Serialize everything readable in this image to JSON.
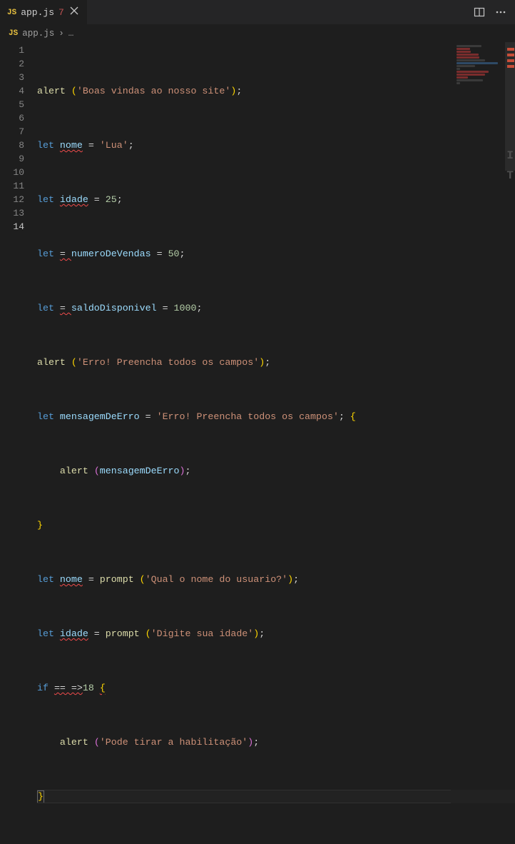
{
  "tab": {
    "icon_label": "JS",
    "filename": "app.js",
    "problem_count": "7"
  },
  "breadcrumb": {
    "icon_label": "JS",
    "filename": "app.js",
    "sep": "›",
    "trail": "…"
  },
  "gutter": {
    "start": 1,
    "end": 14,
    "active": 14
  },
  "code": {
    "l1_fn": "alert ",
    "l1_str": "'Boas vindas ao nosso site'",
    "l2_kw": "let ",
    "l2_var": "nome",
    "l2_eq": " = ",
    "l2_str": "'Lua'",
    "l3_kw": "let ",
    "l3_var": "idade",
    "l3_eq": " = ",
    "l3_num": "25",
    "l4_kw": "let ",
    "l4_eq1": "= ",
    "l4_var": "numeroDeVendas",
    "l4_eq2": " = ",
    "l4_num": "50",
    "l5_kw": "let ",
    "l5_eq1": "= ",
    "l5_var": "saldoDisponivel",
    "l5_eq2": " = ",
    "l5_num": "1000",
    "l6_fn": "alert ",
    "l6_str": "'Erro! Preencha todos os campos'",
    "l7_kw": "let ",
    "l7_var": "mensagemDeErro",
    "l7_eq": " = ",
    "l7_str": "'Erro! Preencha todos os campos'",
    "l8_fn": "alert ",
    "l8_arg": "mensagemDeErro",
    "l10_kw": "let ",
    "l10_var": "nome",
    "l10_eq": " = ",
    "l10_fn": "prompt ",
    "l10_str": "'Qual o nome do usuario?'",
    "l11_kw": "let ",
    "l11_var": "idade",
    "l11_eq": " = ",
    "l11_fn": "prompt ",
    "l11_str": "'Digite sua idade'",
    "l12_kw": "if ",
    "l12_op": "== =>",
    "l12_num": "18",
    "l13_fn": "alert ",
    "l13_str": "'Pode tirar a habilitação'",
    "semicolon": ";",
    "open_paren": "(",
    "close_paren": ")",
    "open_brace": "{",
    "close_brace": "}",
    "indent1": "    ",
    "indent2": "        "
  }
}
